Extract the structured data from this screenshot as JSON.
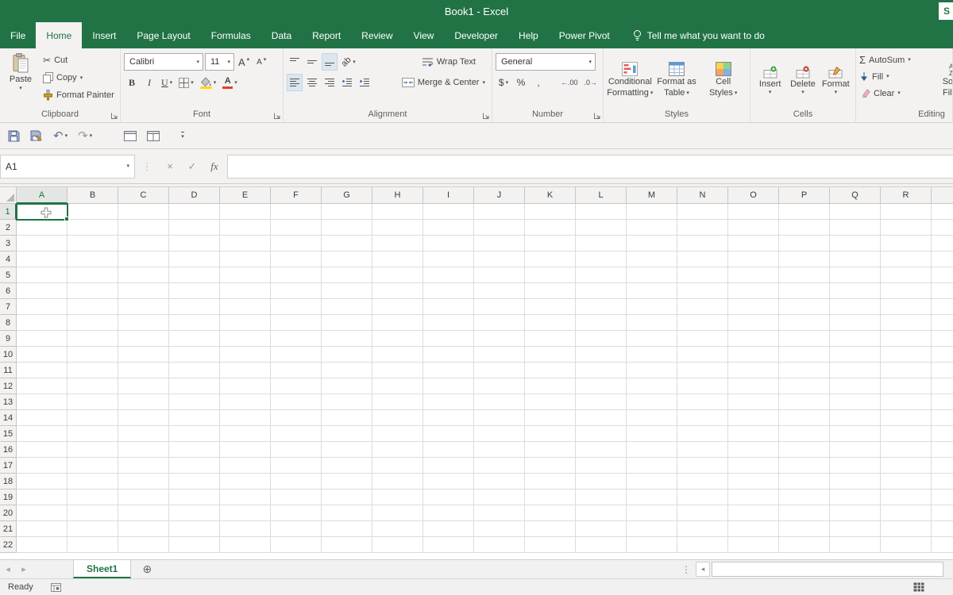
{
  "titlebar": {
    "title": "Book1  -  Excel",
    "share": "S"
  },
  "tabs": {
    "items": [
      {
        "label": "File"
      },
      {
        "label": "Home"
      },
      {
        "label": "Insert"
      },
      {
        "label": "Page Layout"
      },
      {
        "label": "Formulas"
      },
      {
        "label": "Data"
      },
      {
        "label": "Report"
      },
      {
        "label": "Review"
      },
      {
        "label": "View"
      },
      {
        "label": "Developer"
      },
      {
        "label": "Help"
      },
      {
        "label": "Power Pivot"
      }
    ],
    "tell_me": "Tell me what you want to do"
  },
  "ribbon": {
    "clipboard": {
      "label": "Clipboard",
      "paste": "Paste",
      "cut": "Cut",
      "copy": "Copy",
      "format_painter": "Format Painter"
    },
    "font": {
      "label": "Font",
      "family": "Calibri",
      "size": "11",
      "bold": "B",
      "italic": "I",
      "underline": "U"
    },
    "alignment": {
      "label": "Alignment",
      "wrap_text": "Wrap Text",
      "merge_center": "Merge & Center"
    },
    "number": {
      "label": "Number",
      "format": "General",
      "currency": "$",
      "percent": "%",
      "comma": ","
    },
    "styles": {
      "label": "Styles",
      "conditional_line1": "Conditional",
      "conditional_line2": "Formatting",
      "table_line1": "Format as",
      "table_line2": "Table",
      "cell_line1": "Cell",
      "cell_line2": "Styles"
    },
    "cells": {
      "label": "Cells",
      "insert": "Insert",
      "delete": "Delete",
      "format": "Format"
    },
    "editing": {
      "label": "Editing",
      "autosum": "AutoSum",
      "fill": "Fill",
      "clear": "Clear",
      "sort_line1": "Sort &",
      "sort_line2": "Filter"
    }
  },
  "formula_bar": {
    "name_box": "A1",
    "fx": "fx",
    "value": ""
  },
  "grid": {
    "columns": [
      "A",
      "B",
      "C",
      "D",
      "E",
      "F",
      "G",
      "H",
      "I",
      "J",
      "K",
      "L",
      "M",
      "N",
      "O",
      "P",
      "Q",
      "R"
    ],
    "rows": [
      "1",
      "2",
      "3",
      "4",
      "5",
      "6",
      "7",
      "8",
      "9",
      "10",
      "11",
      "12",
      "13",
      "14",
      "15",
      "16",
      "17",
      "18",
      "19",
      "20",
      "21",
      "22"
    ],
    "selected_cell": "A1"
  },
  "sheet_bar": {
    "active_sheet": "Sheet1"
  },
  "status_bar": {
    "status": "Ready"
  }
}
